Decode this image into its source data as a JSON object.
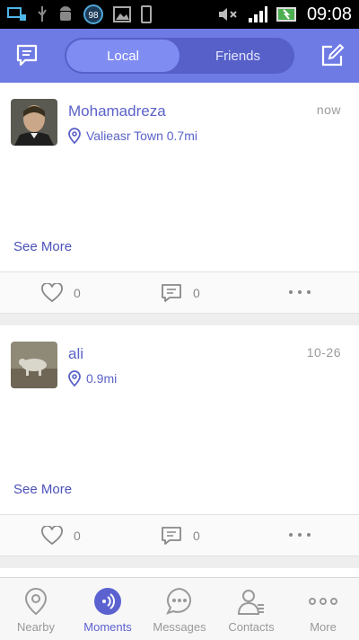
{
  "status_bar": {
    "time": "09:08",
    "badge": "98"
  },
  "header": {
    "tabs": [
      {
        "label": "Local",
        "active": true
      },
      {
        "label": "Friends",
        "active": false
      }
    ],
    "left_icon": "chat-bubble-icon",
    "right_icon": "compose-icon"
  },
  "posts": [
    {
      "username": "Mohamadreza",
      "location": "Valieasr Town 0.7mi",
      "time": "now",
      "see_more": "See More",
      "likes": "0",
      "comments": "0"
    },
    {
      "username": "ali",
      "location": "0.9mi",
      "time": "10-26",
      "see_more": "See More",
      "likes": "0",
      "comments": "0"
    }
  ],
  "bottom_nav": {
    "items": [
      {
        "label": "Nearby",
        "icon": "location-pin-icon"
      },
      {
        "label": "Moments",
        "icon": "moments-icon"
      },
      {
        "label": "Messages",
        "icon": "messages-icon"
      },
      {
        "label": "Contacts",
        "icon": "contacts-icon"
      },
      {
        "label": "More",
        "icon": "more-icon"
      }
    ],
    "active": "Moments"
  },
  "colors": {
    "header": "#6f7be4",
    "accent": "#5b62c8",
    "inactive": "#999999"
  }
}
